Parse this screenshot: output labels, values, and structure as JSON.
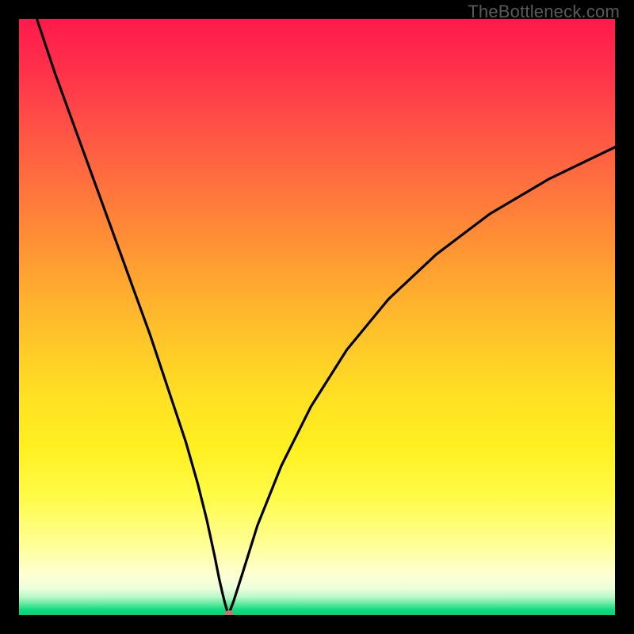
{
  "watermark": "TheBottleneck.com",
  "chart_data": {
    "type": "line",
    "title": "",
    "xlabel": "",
    "ylabel": "",
    "xlim": [
      0,
      100
    ],
    "ylim": [
      0,
      100
    ],
    "grid": false,
    "legend": false,
    "series": [
      {
        "name": "curve-left",
        "x": [
          3,
          6,
          10,
          14,
          18,
          22,
          25,
          28,
          30,
          31.5,
          32.8,
          33.6,
          34.2,
          34.6,
          34.9,
          35.2
        ],
        "y": [
          100,
          91,
          80,
          69,
          58,
          47,
          38,
          29,
          22,
          16,
          10,
          6,
          3.4,
          1.8,
          0.8,
          0.15
        ]
      },
      {
        "name": "curve-right",
        "x": [
          35.2,
          36,
          37.5,
          40,
          44,
          49,
          55,
          62,
          70,
          79,
          89,
          100
        ],
        "y": [
          0.15,
          2.3,
          7,
          15,
          25,
          35,
          44.5,
          53,
          60.5,
          67.3,
          73.2,
          78.5
        ]
      }
    ],
    "cusp": {
      "x": 35.2,
      "y": 0.15
    },
    "background_gradient": {
      "orientation": "vertical",
      "stops": [
        {
          "pct": 0,
          "color": "#ff1a4d"
        },
        {
          "pct": 26,
          "color": "#ff6b3f"
        },
        {
          "pct": 55,
          "color": "#ffc928"
        },
        {
          "pct": 80,
          "color": "#fffb46"
        },
        {
          "pct": 95,
          "color": "#ecffdc"
        },
        {
          "pct": 100,
          "color": "#00d477"
        }
      ]
    }
  }
}
